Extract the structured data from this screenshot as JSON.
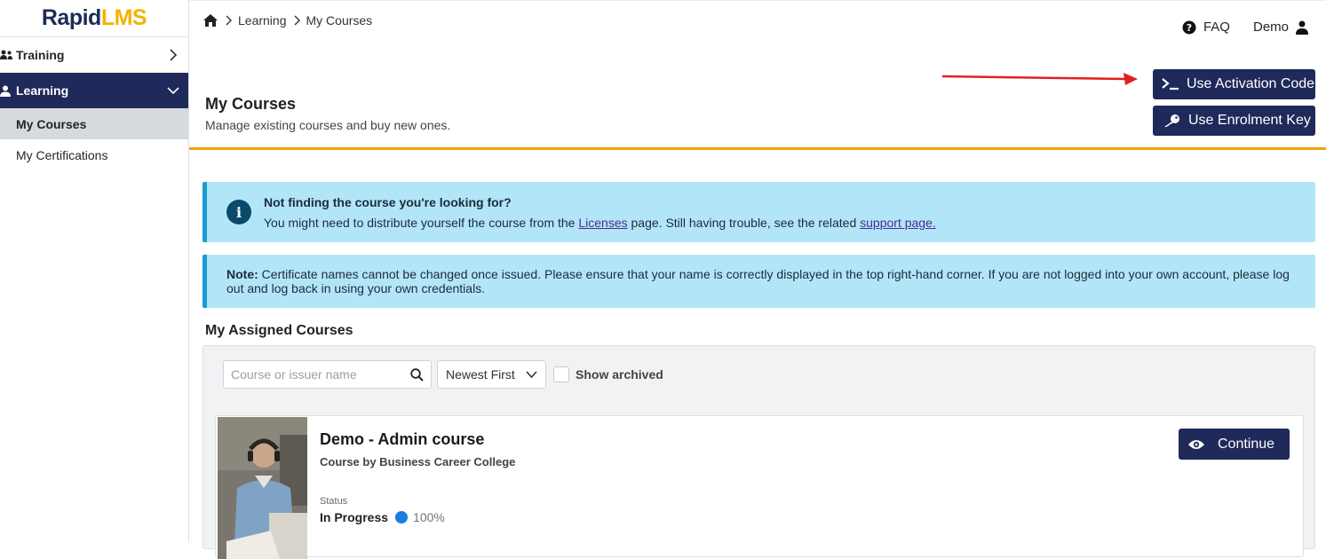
{
  "logo": {
    "part1": "Rapid",
    "part2": "LMS"
  },
  "sidebar": {
    "items": [
      {
        "label": "Training"
      },
      {
        "label": "Learning"
      }
    ],
    "subitems": [
      {
        "label": "My Courses"
      },
      {
        "label": "My Certifications"
      }
    ]
  },
  "breadcrumb": {
    "items": [
      "Learning",
      "My Courses"
    ]
  },
  "topbar": {
    "faq_label": "FAQ",
    "user_label": "Demo"
  },
  "header": {
    "title": "My Courses",
    "subtitle": "Manage existing courses and buy new ones.",
    "activation_button": "Use Activation Code",
    "enrolment_button": "Use Enrolment Key"
  },
  "info_alert": {
    "title": "Not finding the course you're looking for?",
    "text_before": "You might need to distribute yourself the course from the ",
    "link1": "Licenses",
    "text_middle": " page. Still having trouble, see the related ",
    "link2": "support page."
  },
  "note_alert": {
    "label": "Note:",
    "text": " Certificate names cannot be changed once issued. Please ensure that your name is correctly displayed in the top right-hand corner. If you are not logged into your own account, please log out and log back in using your own credentials."
  },
  "assigned": {
    "title": "My Assigned Courses",
    "search_placeholder": "Course or issuer name",
    "sort_value": "Newest First",
    "archived_label": "Show archived"
  },
  "course": {
    "title": "Demo - Admin course",
    "issuer": "Course by Business Career College",
    "status_label": "Status",
    "status_value": "In Progress",
    "progress": "100%",
    "continue_label": "Continue"
  },
  "colors": {
    "primary": "#1f2a5a",
    "accent": "#f0a500",
    "info_bg": "#b3e5f8",
    "info_border": "#1b9bd1",
    "arrow": "#e02020",
    "progress_dot": "#1b7de0"
  },
  "icons": [
    "users-icon",
    "user-icon",
    "home-icon",
    "question-circle-icon",
    "terminal-icon",
    "key-icon",
    "info-icon",
    "search-icon",
    "chevron-down-icon",
    "eye-icon"
  ]
}
